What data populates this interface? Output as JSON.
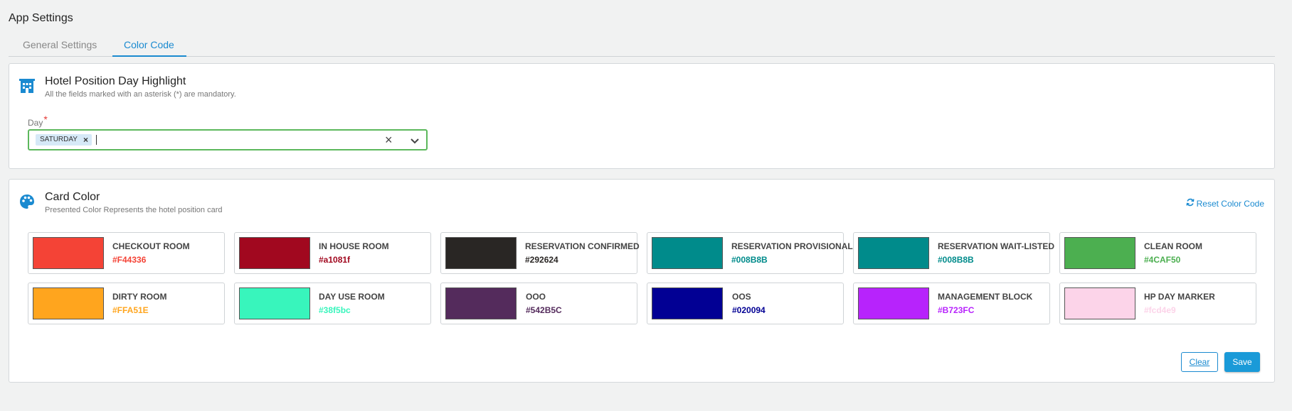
{
  "header": {
    "title": "App Settings"
  },
  "tabs": [
    {
      "label": "General Settings",
      "active": false
    },
    {
      "label": "Color Code",
      "active": true
    }
  ],
  "hotel_position": {
    "title": "Hotel Position Day Highlight",
    "subtitle": "All the fields marked with an asterisk (*) are mandatory.",
    "icon": "building-icon",
    "day_field": {
      "label": "Day",
      "required_mark": "*",
      "selected": [
        "SATURDAY"
      ]
    }
  },
  "card_color": {
    "title": "Card Color",
    "subtitle": "Presented Color Represents the hotel position card",
    "icon": "palette-icon",
    "reset_label": "Reset Color Code",
    "cards": [
      {
        "name": "CHECKOUT ROOM",
        "hex": "#F44336",
        "color": "#F44336"
      },
      {
        "name": "IN HOUSE ROOM",
        "hex": "#a1081f",
        "color": "#a1081f"
      },
      {
        "name": "RESERVATION CONFIRMED",
        "hex": "#292624",
        "color": "#292624"
      },
      {
        "name": "RESERVATION PROVISIONAL",
        "hex": "#008B8B",
        "color": "#008B8B"
      },
      {
        "name": "RESERVATION WAIT-LISTED",
        "hex": "#008B8B",
        "color": "#008B8B"
      },
      {
        "name": "CLEAN ROOM",
        "hex": "#4CAF50",
        "color": "#4CAF50"
      },
      {
        "name": "DIRTY ROOM",
        "hex": "#FFA51E",
        "color": "#FFA51E"
      },
      {
        "name": "DAY USE ROOM",
        "hex": "#38f5bc",
        "color": "#38f5bc"
      },
      {
        "name": "OOO",
        "hex": "#542B5C",
        "color": "#542B5C"
      },
      {
        "name": "OOS",
        "hex": "#020094",
        "color": "#020094"
      },
      {
        "name": "MANAGEMENT BLOCK",
        "hex": "#B723FC",
        "color": "#B723FC"
      },
      {
        "name": "HP DAY MARKER",
        "hex": "#fcd4e9",
        "color": "#fcd4e9"
      }
    ]
  },
  "actions": {
    "clear_label": "Clear",
    "save_label": "Save"
  },
  "colors": {
    "accent": "#1a8ad0",
    "valid_border": "#5cb85c",
    "required": "#e53935"
  }
}
